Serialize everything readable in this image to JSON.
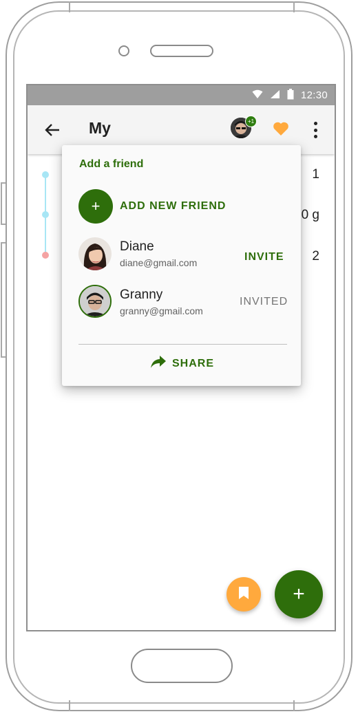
{
  "status_bar": {
    "time": "12:30"
  },
  "app_bar": {
    "title": "My",
    "badge": "+1"
  },
  "background_values": [
    "1",
    "0 g",
    "2"
  ],
  "popup": {
    "title": "Add a friend",
    "add_icon": "+",
    "add_label": "ADD NEW FRIEND",
    "friends": [
      {
        "name": "Diane",
        "email": "diane@gmail.com",
        "action": "INVITE"
      },
      {
        "name": "Granny",
        "email": "granny@gmail.com",
        "status": "INVITED"
      }
    ],
    "share_label": "SHARE"
  },
  "fab": {
    "main_icon": "+"
  },
  "colors": {
    "accent_green": "#2e6e0b",
    "accent_orange": "#ffa93d",
    "status_bar": "#9e9e9e",
    "timeline_blue": "#a8e6f5",
    "timeline_red": "#f4a3a3"
  },
  "icons": [
    "back-arrow-icon",
    "wifi-icon",
    "signal-icon",
    "battery-icon",
    "heart-icon",
    "more-vert-icon",
    "share-icon",
    "bookmark-icon",
    "plus-icon"
  ]
}
